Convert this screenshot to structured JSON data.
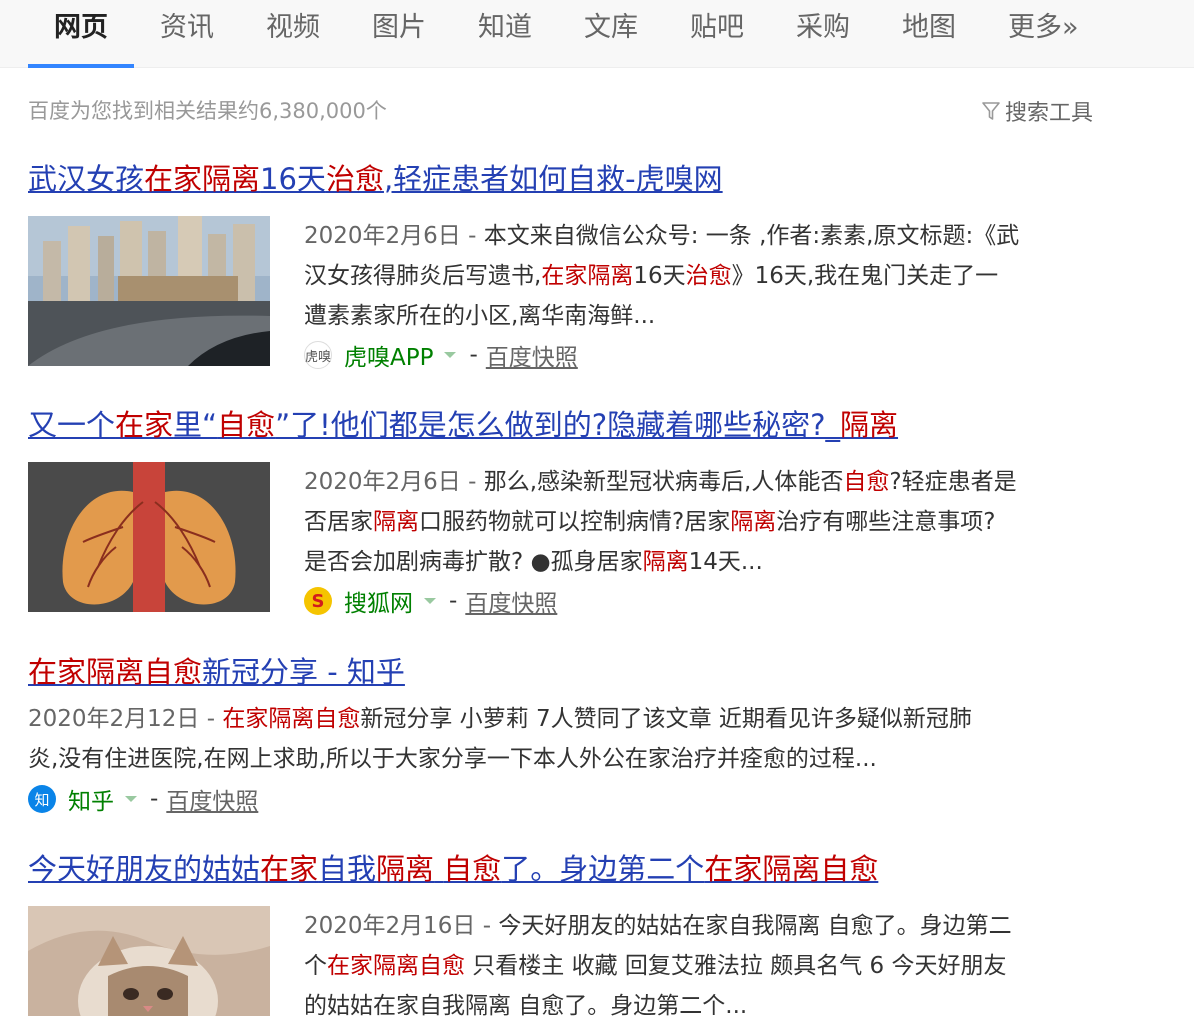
{
  "tabs": [
    "网页",
    "资讯",
    "视频",
    "图片",
    "知道",
    "文库",
    "贴吧",
    "采购",
    "地图",
    "更多»"
  ],
  "summary": "百度为您找到相关结果约6,380,000个",
  "search_tools": "搜索工具",
  "results": [
    {
      "title": [
        {
          "t": "武汉女孩",
          "hl": false
        },
        {
          "t": "在家隔离",
          "hl": true
        },
        {
          "t": "16天",
          "hl": false
        },
        {
          "t": "治愈",
          "hl": true
        },
        {
          "t": ",轻症患者如何自救-虎嗅网",
          "hl": false
        }
      ],
      "date": "2020年2月6日",
      "abstract": [
        {
          "t": "本文来自微信公众号: 一条 ,作者:素素,原文标题:《武",
          "hl": false,
          "br": true
        },
        {
          "t": "汉女孩得肺炎后写遗书,",
          "hl": false
        },
        {
          "t": "在家隔离",
          "hl": true
        },
        {
          "t": "16天",
          "hl": false
        },
        {
          "t": "治愈",
          "hl": true
        },
        {
          "t": "》16天,我在鬼门关走了一",
          "hl": false,
          "br": true
        },
        {
          "t": "遭素素家所在的小区,离华南海鲜...",
          "hl": false
        }
      ],
      "source_icon_text": "虎嗅",
      "source": "虎嗅APP",
      "cache": "百度快照"
    },
    {
      "title": [
        {
          "t": "又一个",
          "hl": false
        },
        {
          "t": "在家",
          "hl": true
        },
        {
          "t": "里“",
          "hl": false
        },
        {
          "t": "自愈",
          "hl": true
        },
        {
          "t": "”了!他们都是怎么做到的?隐藏着哪些秘密?_",
          "hl": false
        },
        {
          "t": "隔离",
          "hl": true
        }
      ],
      "date": "2020年2月6日",
      "abstract": [
        {
          "t": "那么,感染新型冠状病毒后,人体能否",
          "hl": false
        },
        {
          "t": "自愈",
          "hl": true
        },
        {
          "t": "?轻症患者是",
          "hl": false,
          "br": true
        },
        {
          "t": "否居家",
          "hl": false
        },
        {
          "t": "隔离",
          "hl": true
        },
        {
          "t": "口服药物就可以控制病情?居家",
          "hl": false
        },
        {
          "t": "隔离",
          "hl": true
        },
        {
          "t": "治疗有哪些注意事项?",
          "hl": false,
          "br": true
        },
        {
          "t": "是否会加剧病毒扩散? ●孤身居家",
          "hl": false
        },
        {
          "t": "隔离",
          "hl": true
        },
        {
          "t": "14天...",
          "hl": false
        }
      ],
      "source_icon_text": "S",
      "source": "搜狐网",
      "cache": "百度快照"
    },
    {
      "title": [
        {
          "t": "在家隔离自愈",
          "hl": true
        },
        {
          "t": "新冠分享 - 知乎",
          "hl": false
        }
      ],
      "date": "2020年2月12日",
      "abstract": [
        {
          "t": "在家隔离自愈",
          "hl": true
        },
        {
          "t": "新冠分享 小萝莉 7人赞同了该文章 近期看见许多疑似新冠肺",
          "hl": false,
          "br": true
        },
        {
          "t": "炎,没有住进医院,在网上求助,所以于大家分享一下本人外公在家治疗并痊愈的过程...",
          "hl": false
        }
      ],
      "source_icon_text": "知",
      "source": "知乎",
      "cache": "百度快照"
    },
    {
      "title": [
        {
          "t": "今天好朋友的姑姑",
          "hl": false
        },
        {
          "t": "在家",
          "hl": true
        },
        {
          "t": "自我",
          "hl": false
        },
        {
          "t": "隔离",
          "hl": true
        },
        {
          "t": " ",
          "hl": false
        },
        {
          "t": "自愈",
          "hl": true
        },
        {
          "t": "了。身边第二个",
          "hl": false
        },
        {
          "t": "在家隔离自愈",
          "hl": true
        }
      ],
      "date": "2020年2月16日",
      "abstract": [
        {
          "t": "今天好朋友的姑姑在家自我隔离 自愈了。身边第二",
          "hl": false,
          "br": true
        },
        {
          "t": "个",
          "hl": false
        },
        {
          "t": "在家隔离自愈",
          "hl": true
        },
        {
          "t": " 只看楼主 收藏 回复艾雅法拉 颇具名气 6 今天好朋友",
          "hl": false,
          "br": true
        },
        {
          "t": "的姑姑在家自我隔离 自愈了。身边第二个...",
          "hl": false
        }
      ]
    }
  ]
}
